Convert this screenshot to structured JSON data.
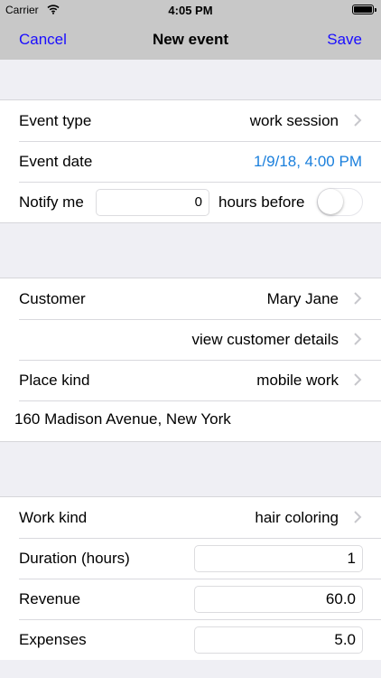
{
  "status_bar": {
    "carrier": "Carrier",
    "time": "4:05 PM"
  },
  "nav": {
    "cancel": "Cancel",
    "title": "New event",
    "save": "Save"
  },
  "event_section": {
    "event_type_label": "Event type",
    "event_type_value": "work session",
    "event_date_label": "Event date",
    "event_date_value": "1/9/18, 4:00 PM",
    "notify_label": "Notify me",
    "notify_hours": "0",
    "notify_suffix": "hours before",
    "notify_enabled": false
  },
  "customer_section": {
    "customer_label": "Customer",
    "customer_value": "Mary Jane",
    "view_details": "view customer details",
    "place_kind_label": "Place kind",
    "place_kind_value": "mobile work",
    "address": "160 Madison Avenue, New York"
  },
  "work_section": {
    "work_kind_label": "Work kind",
    "work_kind_value": "hair coloring",
    "duration_label": "Duration (hours)",
    "duration_value": "1",
    "revenue_label": "Revenue",
    "revenue_value": "60.0",
    "expenses_label": "Expenses",
    "expenses_value": "5.0"
  },
  "colors": {
    "nav_bg": "#c8c8c8",
    "link_blue": "#1a0dff",
    "date_blue": "#1a7fdc",
    "group_bg": "#efeff4"
  }
}
